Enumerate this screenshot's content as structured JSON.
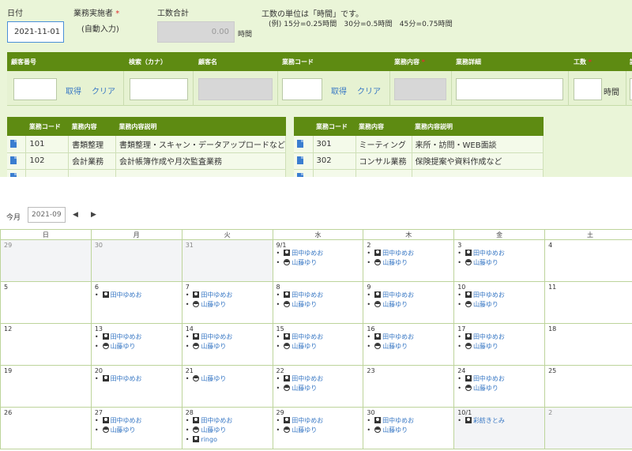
{
  "form": {
    "date_label": "日付",
    "date_value": "2021-11-01",
    "staff_label": "業務実施者",
    "required_mark": "*",
    "staff_value": "(自動入力)",
    "total_label": "工数合計",
    "total_value": "0.00",
    "hours_unit": "時間",
    "note_line1": "工数の単位は「時間」です。",
    "note_line2": "(例) 15分=0.25時間　30分=0.5時間　45分=0.75時間"
  },
  "entry": {
    "headers": {
      "customer_no": "顧客番号",
      "search_kana": "検索（カナ）",
      "customer_name": "顧客名",
      "work_code": "業務コード",
      "work_content": "業務内容",
      "work_detail": "業務詳細",
      "hours": "工数",
      "cut": "詳"
    },
    "fetch_label": "取得",
    "clear_label": "クリア",
    "hours_unit": "時間"
  },
  "tables": {
    "headers": [
      "業務コード",
      "業務内容",
      "業務内容説明"
    ],
    "left_rows": [
      {
        "code": "101",
        "name": "書類整理",
        "desc": "書類整理・スキャン・データアップロードなど"
      },
      {
        "code": "102",
        "name": "会計業務",
        "desc": "会計帳簿作成や月次監査業務"
      }
    ],
    "right_rows": [
      {
        "code": "301",
        "name": "ミーティング",
        "desc": "来所・訪問・WEB面談"
      },
      {
        "code": "302",
        "name": "コンサル業務",
        "desc": "保険提案や資料作成など"
      }
    ]
  },
  "calendar": {
    "today_label": "今月",
    "month_value": "2021-09",
    "prev_icon": "◀",
    "next_icon": "▶",
    "weekdays": [
      "日",
      "月",
      "火",
      "水",
      "木",
      "金",
      "土"
    ],
    "weeks": [
      [
        {
          "d": "29",
          "other": true,
          "ev": []
        },
        {
          "d": "30",
          "other": true,
          "ev": []
        },
        {
          "d": "31",
          "other": true,
          "ev": []
        },
        {
          "d": "9/1",
          "ev": [
            {
              "n": "田中ゆめお",
              "i": "p"
            },
            {
              "n": "山藤ゆり",
              "i": "m"
            }
          ]
        },
        {
          "d": "2",
          "ev": [
            {
              "n": "田中ゆめお",
              "i": "p"
            },
            {
              "n": "山藤ゆり",
              "i": "m"
            }
          ]
        },
        {
          "d": "3",
          "ev": [
            {
              "n": "田中ゆめお",
              "i": "p"
            },
            {
              "n": "山藤ゆり",
              "i": "m"
            }
          ]
        },
        {
          "d": "4",
          "ev": []
        }
      ],
      [
        {
          "d": "5",
          "ev": []
        },
        {
          "d": "6",
          "ev": [
            {
              "n": "田中ゆめお",
              "i": "p"
            }
          ]
        },
        {
          "d": "7",
          "ev": [
            {
              "n": "田中ゆめお",
              "i": "p"
            },
            {
              "n": "山藤ゆり",
              "i": "m"
            }
          ]
        },
        {
          "d": "8",
          "ev": [
            {
              "n": "田中ゆめお",
              "i": "p"
            },
            {
              "n": "山藤ゆり",
              "i": "m"
            }
          ]
        },
        {
          "d": "9",
          "ev": [
            {
              "n": "田中ゆめお",
              "i": "p"
            },
            {
              "n": "山藤ゆり",
              "i": "m"
            }
          ]
        },
        {
          "d": "10",
          "ev": [
            {
              "n": "田中ゆめお",
              "i": "p"
            },
            {
              "n": "山藤ゆり",
              "i": "m"
            }
          ]
        },
        {
          "d": "11",
          "ev": []
        }
      ],
      [
        {
          "d": "12",
          "ev": []
        },
        {
          "d": "13",
          "ev": [
            {
              "n": "田中ゆめお",
              "i": "p"
            },
            {
              "n": "山藤ゆり",
              "i": "m"
            }
          ]
        },
        {
          "d": "14",
          "ev": [
            {
              "n": "田中ゆめお",
              "i": "p"
            },
            {
              "n": "山藤ゆり",
              "i": "m"
            }
          ]
        },
        {
          "d": "15",
          "ev": [
            {
              "n": "田中ゆめお",
              "i": "p"
            },
            {
              "n": "山藤ゆり",
              "i": "m"
            }
          ]
        },
        {
          "d": "16",
          "ev": [
            {
              "n": "田中ゆめお",
              "i": "p"
            },
            {
              "n": "山藤ゆり",
              "i": "m"
            }
          ]
        },
        {
          "d": "17",
          "ev": [
            {
              "n": "田中ゆめお",
              "i": "p"
            },
            {
              "n": "山藤ゆり",
              "i": "m"
            }
          ]
        },
        {
          "d": "18",
          "ev": []
        }
      ],
      [
        {
          "d": "19",
          "ev": []
        },
        {
          "d": "20",
          "ev": [
            {
              "n": "田中ゆめお",
              "i": "p"
            }
          ]
        },
        {
          "d": "21",
          "ev": [
            {
              "n": "山藤ゆり",
              "i": "m"
            }
          ]
        },
        {
          "d": "22",
          "ev": [
            {
              "n": "田中ゆめお",
              "i": "p"
            },
            {
              "n": "山藤ゆり",
              "i": "m"
            }
          ]
        },
        {
          "d": "23",
          "ev": []
        },
        {
          "d": "24",
          "ev": [
            {
              "n": "田中ゆめお",
              "i": "p"
            },
            {
              "n": "山藤ゆり",
              "i": "m"
            }
          ]
        },
        {
          "d": "25",
          "ev": []
        }
      ],
      [
        {
          "d": "26",
          "ev": []
        },
        {
          "d": "27",
          "ev": [
            {
              "n": "田中ゆめお",
              "i": "p"
            },
            {
              "n": "山藤ゆり",
              "i": "m"
            }
          ]
        },
        {
          "d": "28",
          "ev": [
            {
              "n": "田中ゆめお",
              "i": "p"
            },
            {
              "n": "山藤ゆり",
              "i": "m"
            },
            {
              "n": "ringo",
              "i": "p"
            }
          ]
        },
        {
          "d": "29",
          "ev": [
            {
              "n": "田中ゆめお",
              "i": "p"
            },
            {
              "n": "山藤ゆり",
              "i": "m"
            }
          ]
        },
        {
          "d": "30",
          "ev": [
            {
              "n": "田中ゆめお",
              "i": "p"
            },
            {
              "n": "山藤ゆり",
              "i": "m"
            }
          ]
        },
        {
          "d": "10/1",
          "other": true,
          "ev": [
            {
              "n": "彩紡きとみ",
              "i": "p"
            }
          ]
        },
        {
          "d": "2",
          "other": true,
          "ev": []
        }
      ]
    ]
  }
}
